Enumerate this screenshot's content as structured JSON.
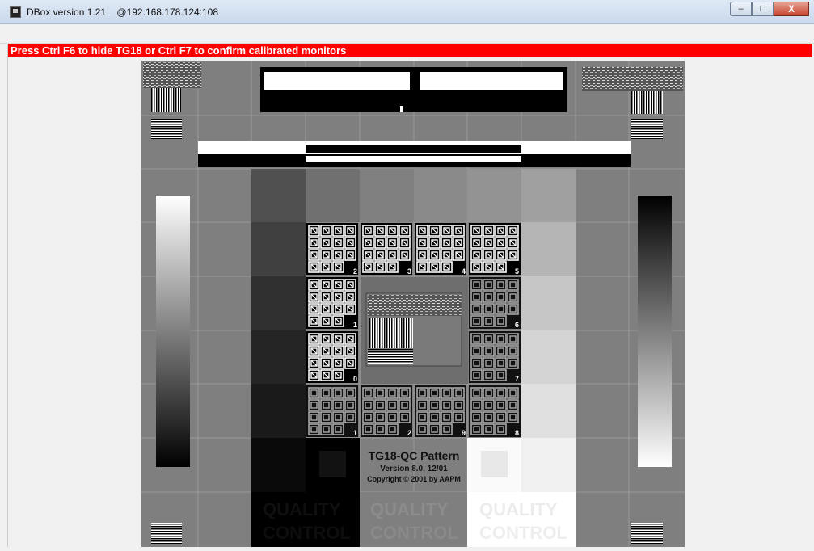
{
  "window": {
    "title": "DBox version 1.21",
    "address": "@192.168.178.124:108",
    "minimize_glyph": "–",
    "maximize_glyph": "□",
    "close_glyph": "X",
    "app_icon": "dbox-app-icon"
  },
  "banner": {
    "text": "Press Ctrl F6 to hide TG18 or Ctrl F7 to confirm calibrated monitors",
    "color": "#ff0000"
  },
  "pattern": {
    "name": "TG18-QC Pattern",
    "version": "Version 8.0, 12/01",
    "copyright": "Copyright © 2001 by AAPM",
    "quality_word": "QUALITY",
    "control_word": "CONTROL",
    "patch_numbers": [
      "2",
      "3",
      "4",
      "5",
      "1",
      "6",
      "0",
      "7",
      "1",
      "2",
      "9",
      "8"
    ]
  }
}
